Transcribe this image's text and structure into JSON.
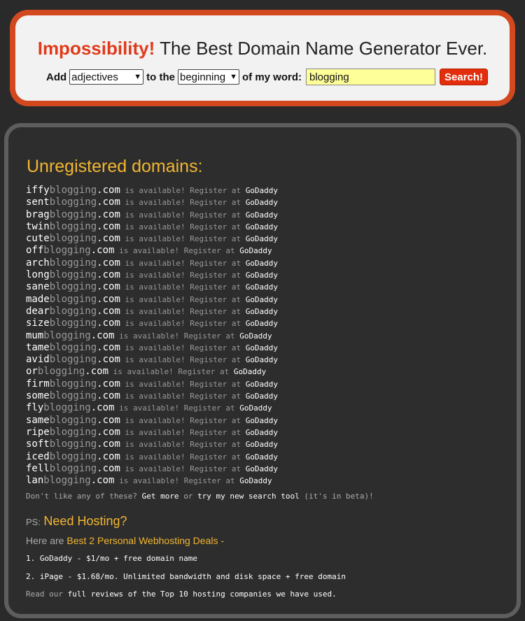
{
  "header": {
    "brand": "Impossibility!",
    "tagline": "The Best Domain Name Generator Ever.",
    "form": {
      "add_label": "Add",
      "type_selected": "adjectives",
      "to_the_label": "to the",
      "position_selected": "beginning",
      "of_word_label": "of my word:",
      "word_value": "blogging",
      "search_label": "Search!"
    }
  },
  "results": {
    "title": "Unregistered domains:",
    "base": "blogging",
    "tld": ".com",
    "available_text": " is available! Register at ",
    "registrar": "GoDaddy",
    "domains": [
      {
        "word": "iffy"
      },
      {
        "word": "sent"
      },
      {
        "word": "brag"
      },
      {
        "word": "twin"
      },
      {
        "word": "cute"
      },
      {
        "word": "off"
      },
      {
        "word": "arch"
      },
      {
        "word": "long"
      },
      {
        "word": "sane"
      },
      {
        "word": "made"
      },
      {
        "word": "dear"
      },
      {
        "word": "size"
      },
      {
        "word": "mum"
      },
      {
        "word": "tame"
      },
      {
        "word": "avid"
      },
      {
        "word": "or"
      },
      {
        "word": "firm"
      },
      {
        "word": "some"
      },
      {
        "word": "fly"
      },
      {
        "word": "same"
      },
      {
        "word": "ripe"
      },
      {
        "word": "soft"
      },
      {
        "word": "iced"
      },
      {
        "word": "fell"
      },
      {
        "word": "lan"
      }
    ]
  },
  "footer": {
    "dont_like": "Don't like any of these?",
    "get_more": "Get more",
    "or": "or",
    "try_tool": "try my new search tool",
    "beta": "(it's in beta)!",
    "ps": "PS:",
    "need_hosting": "Need Hosting?",
    "here_are": "Here are",
    "best_deals": "Best 2 Personal Webhosting Deals -",
    "offer1": "1. GoDaddy - $1/mo + free domain name",
    "offer2": "2. iPage - $1.68/mo. Unlimited bandwidth and disk space + free domain",
    "read_our": "Read our",
    "full_reviews": "full reviews of the Top 10 hosting companies we have used."
  }
}
